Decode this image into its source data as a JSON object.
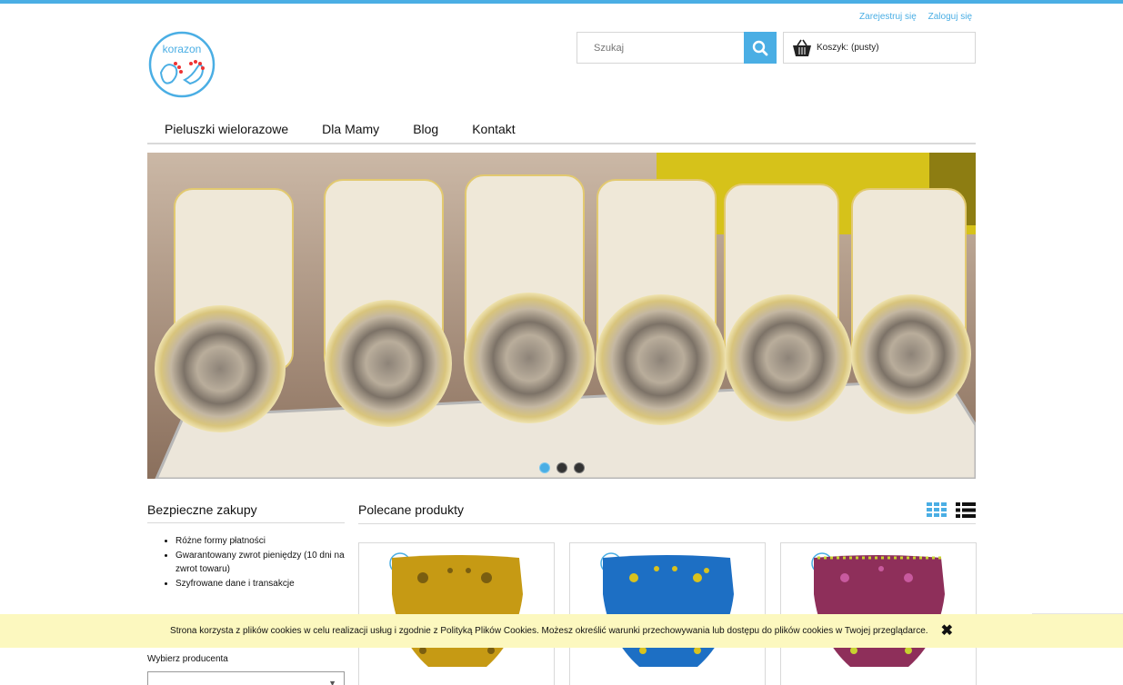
{
  "header": {
    "register_label": "Zarejestruj się",
    "login_label": "Zaloguj się",
    "logo_text": "korazon",
    "search_placeholder": "Szukaj",
    "cart_label": "Koszyk:",
    "cart_status": "(pusty)"
  },
  "nav": {
    "items": [
      {
        "label": "Pieluszki wielorazowe"
      },
      {
        "label": "Dla Mamy"
      },
      {
        "label": "Blog"
      },
      {
        "label": "Kontakt"
      }
    ]
  },
  "slider": {
    "slide_count": 3,
    "active_slide": 1
  },
  "sidebar": {
    "title": "Bezpieczne zakupy",
    "items": [
      "Różne formy płatności",
      "Gwarantowany zwrot pieniędzy (10 dni na zwrot towaru)",
      "Szyfrowane dane i transakcje"
    ],
    "manufacturer_label": "Wybierz producenta",
    "manufacturer_value": ""
  },
  "main": {
    "title": "Polecane produkty",
    "products": [
      {
        "color": "#c69a14"
      },
      {
        "color": "#1d6fc4"
      },
      {
        "color": "#8e2f5a"
      }
    ]
  },
  "cookie": {
    "text": "Strona korzysta z plików cookies w celu realizacji usług i zgodnie z Polityką Plików Cookies. Możesz określić warunki przechowywania lub dostępu do plików cookies w Twojej przeglądarce."
  },
  "colors": {
    "accent": "#4aaee4",
    "cookie_bg": "#fcf8bf"
  }
}
